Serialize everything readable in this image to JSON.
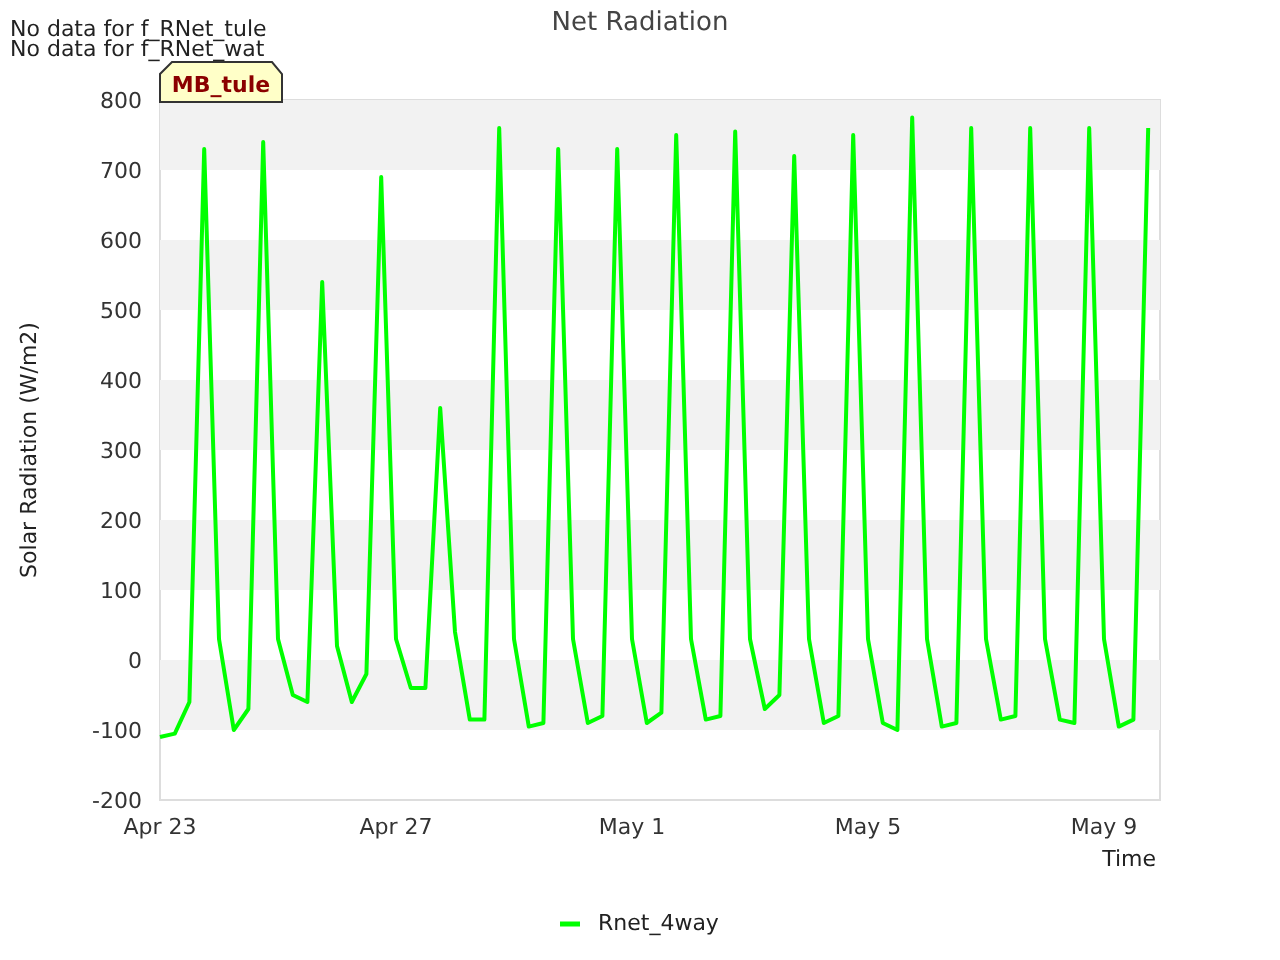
{
  "notices": [
    "No data for f_RNet_tule",
    "No data for f_RNet_wat"
  ],
  "tag": "MB_tule",
  "chart": {
    "chart_data": {
      "type": "line",
      "title": "Net Radiation",
      "xlabel": "Time",
      "ylabel": "Solar Radiation (W/m2)",
      "categories": [
        "Apr 23",
        null,
        null,
        null,
        null,
        null,
        null,
        null,
        null,
        null,
        null,
        null,
        null,
        null,
        null,
        null,
        "Apr 27",
        null,
        null,
        null,
        null,
        null,
        null,
        null,
        null,
        null,
        null,
        null,
        null,
        null,
        null,
        null,
        "May 1",
        null,
        null,
        null,
        null,
        null,
        null,
        null,
        null,
        null,
        null,
        null,
        null,
        null,
        null,
        null,
        "May 5",
        null,
        null,
        null,
        null,
        null,
        null,
        null,
        null,
        null,
        null,
        null,
        null,
        null,
        null,
        null,
        "May 9",
        null,
        null,
        null
      ],
      "series": [
        {
          "name": "Rnet_4way",
          "color": "#00ff00",
          "values": [
            -110,
            -105,
            -60,
            730,
            30,
            -100,
            -70,
            740,
            30,
            -50,
            -60,
            540,
            20,
            -60,
            -20,
            690,
            30,
            -40,
            -40,
            360,
            40,
            -85,
            -85,
            760,
            30,
            -95,
            -90,
            730,
            30,
            -90,
            -80,
            730,
            30,
            -90,
            -75,
            750,
            30,
            -85,
            -80,
            755,
            30,
            -70,
            -50,
            720,
            30,
            -90,
            -80,
            750,
            30,
            -90,
            -100,
            775,
            30,
            -95,
            -90,
            760,
            30,
            -85,
            -80,
            760,
            30,
            -85,
            -90,
            760,
            30,
            -95,
            -85,
            760
          ]
        }
      ],
      "ylim": [
        -200,
        800
      ],
      "yticks": [
        -200,
        -100,
        0,
        100,
        200,
        300,
        400,
        500,
        600,
        700,
        800
      ]
    }
  }
}
